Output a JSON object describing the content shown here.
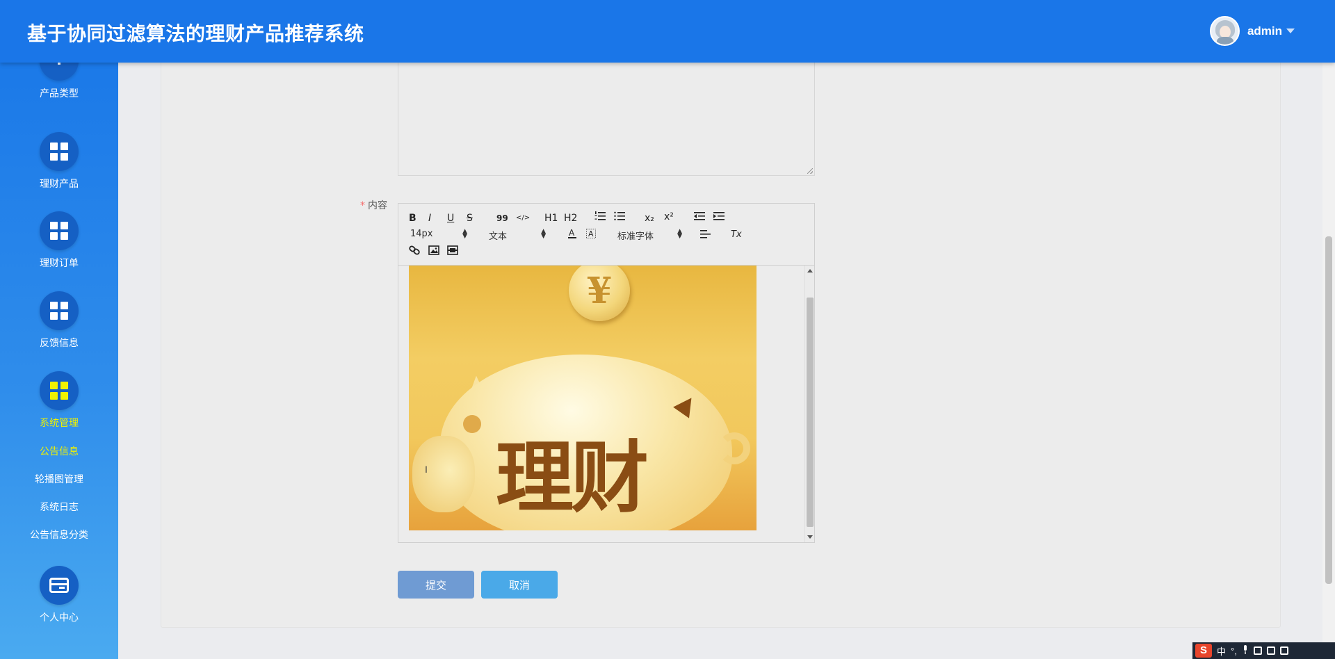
{
  "header": {
    "title": "基于协同过滤算法的理财产品推荐系统",
    "user_name": "admin"
  },
  "sidebar": {
    "items": [
      {
        "label": "产品类型"
      },
      {
        "label": "理财产品"
      },
      {
        "label": "理财订单"
      },
      {
        "label": "反馈信息"
      },
      {
        "label": "系统管理"
      },
      {
        "label": "个人中心"
      }
    ],
    "sub_items": [
      {
        "label": "公告信息"
      },
      {
        "label": "轮播图管理"
      },
      {
        "label": "系统日志"
      },
      {
        "label": "公告信息分类"
      }
    ],
    "active_item": "系统管理",
    "active_sub_item": "公告信息",
    "colors": {
      "active": "#f0f200",
      "background": "#1b79e8"
    }
  },
  "form": {
    "content_label": "内容",
    "required_mark": "*",
    "toolbar": {
      "bold": "B",
      "italic": "I",
      "underline": "U",
      "strike": "S",
      "blockquote": "99",
      "code": "</>",
      "h1": "H1",
      "h2": "H2",
      "subscript": "x₂",
      "superscript": "x²",
      "font_size": "14px",
      "header_select": "文本",
      "font_family": "标准字体",
      "clear_format": "Tx"
    },
    "image_text": {
      "coin": "¥",
      "caption": "理财"
    },
    "submit_label": "提交",
    "cancel_label": "取消"
  },
  "ime": {
    "logo": "S",
    "lang": "中",
    "punct": "°,"
  }
}
